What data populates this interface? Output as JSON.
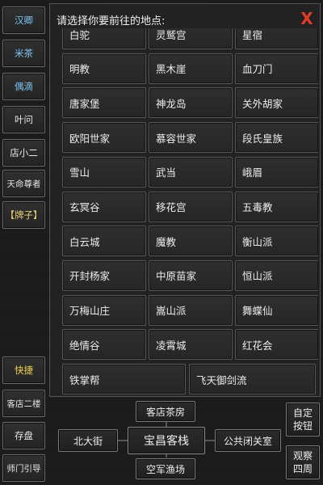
{
  "sidebar": {
    "top_items": [
      {
        "label": "汉卿",
        "color": "#7ec4f2"
      },
      {
        "label": "米茶",
        "color": "#7ec4f2"
      },
      {
        "label": "偶滴",
        "color": "#7ec4f2"
      },
      {
        "label": "叶问",
        "color": "#e6e6e6"
      },
      {
        "label": "店小二",
        "color": "#e6e6e6"
      },
      {
        "label": "天命尊者",
        "color": "#e6e6e6"
      },
      {
        "label": "【牌子】",
        "color": "#e8d27a"
      }
    ],
    "bottom_items": [
      {
        "label": "快捷",
        "color": "#f2d256"
      },
      {
        "label": "客店二楼",
        "color": "#e6e6e6"
      },
      {
        "label": "存盘",
        "color": "#e6e6e6"
      },
      {
        "label": "师门引导",
        "color": "#e6e6e6"
      }
    ]
  },
  "modal": {
    "title": "请选择你要前往的地点:",
    "close_label": "X",
    "locations": [
      [
        "白驼",
        "灵鹫宫",
        "星宿"
      ],
      [
        "明教",
        "黑木崖",
        "血刀门"
      ],
      [
        "唐家堡",
        "神龙岛",
        "关外胡家"
      ],
      [
        "欧阳世家",
        "慕容世家",
        "段氏皇族"
      ],
      [
        "雪山",
        "武当",
        "峨眉"
      ],
      [
        "玄冥谷",
        "移花宫",
        "五毒教"
      ],
      [
        "白云城",
        "魔教",
        "衡山派"
      ],
      [
        "开封杨家",
        "中原苗家",
        "恒山派"
      ],
      [
        "万梅山庄",
        "嵩山派",
        "舞蝶仙"
      ],
      [
        "绝情谷",
        "凌霄城",
        "红花会"
      ],
      [
        "铁掌帮",
        "飞天御剑流"
      ]
    ]
  },
  "map": {
    "north": "客店茶房",
    "west": "北大街",
    "center": "宝昌客栈",
    "east": "公共闭关室",
    "south": "空军渔场"
  },
  "actions": {
    "custom": "自定\n按钮",
    "observe": "观察\n四周"
  },
  "colors": {
    "close": "#e23a2a",
    "accent_blue": "#7ec4f2",
    "accent_yellow": "#f2d256"
  }
}
